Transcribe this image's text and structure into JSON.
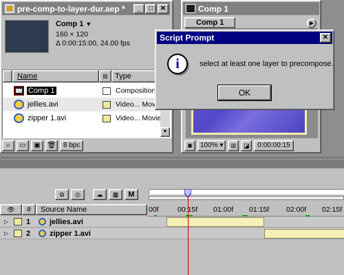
{
  "project": {
    "title": "pre-comp-to-layer-dur.aep *",
    "selected": {
      "name": "Comp 1",
      "dimensions": "160 × 120",
      "duration_fps": "Δ 0:00:15:00, 24.00 fps"
    },
    "columns": {
      "name": "Name",
      "type": "Type"
    },
    "items": [
      {
        "name": "Comp 1",
        "type": "Composition",
        "label_color": "#808080"
      },
      {
        "name": "jellies.avi",
        "type": "Video... Movie",
        "label_color": "#f0eaa0"
      },
      {
        "name": "zipper 1.avi",
        "type": "Video... Movie",
        "label_color": "#f0eaa0"
      }
    ],
    "bpc": "8 bpc"
  },
  "comp_window": {
    "title": "Comp 1",
    "tab": "Comp 1",
    "zoom": "100%",
    "timecode": "0:00:00:15"
  },
  "dialog": {
    "title": "Script Prompt",
    "message": "select at least one layer to precompose.",
    "ok_label": "OK"
  },
  "timeline": {
    "columns": {
      "hash": "#",
      "source": "Source Name"
    },
    "ticks": [
      "00f",
      "00:15f",
      "01:00f",
      "01:15f",
      "02:00f",
      "02:15f"
    ],
    "mode_letter": "M",
    "layers": [
      {
        "index": "1",
        "name": "jellies.avi",
        "start_fraction": 0.0,
        "end_fraction": 0.5
      },
      {
        "index": "2",
        "name": "zipper 1.avi",
        "start_fraction": 0.5,
        "end_fraction": 0.83
      }
    ],
    "current_time_fraction": 0.2
  },
  "colors": {
    "title_active": "#000080",
    "title_inactive": "#808080",
    "face": "#c0c0c0",
    "layer_bar": "#f6f0b8",
    "playhead": "#cc0000"
  }
}
